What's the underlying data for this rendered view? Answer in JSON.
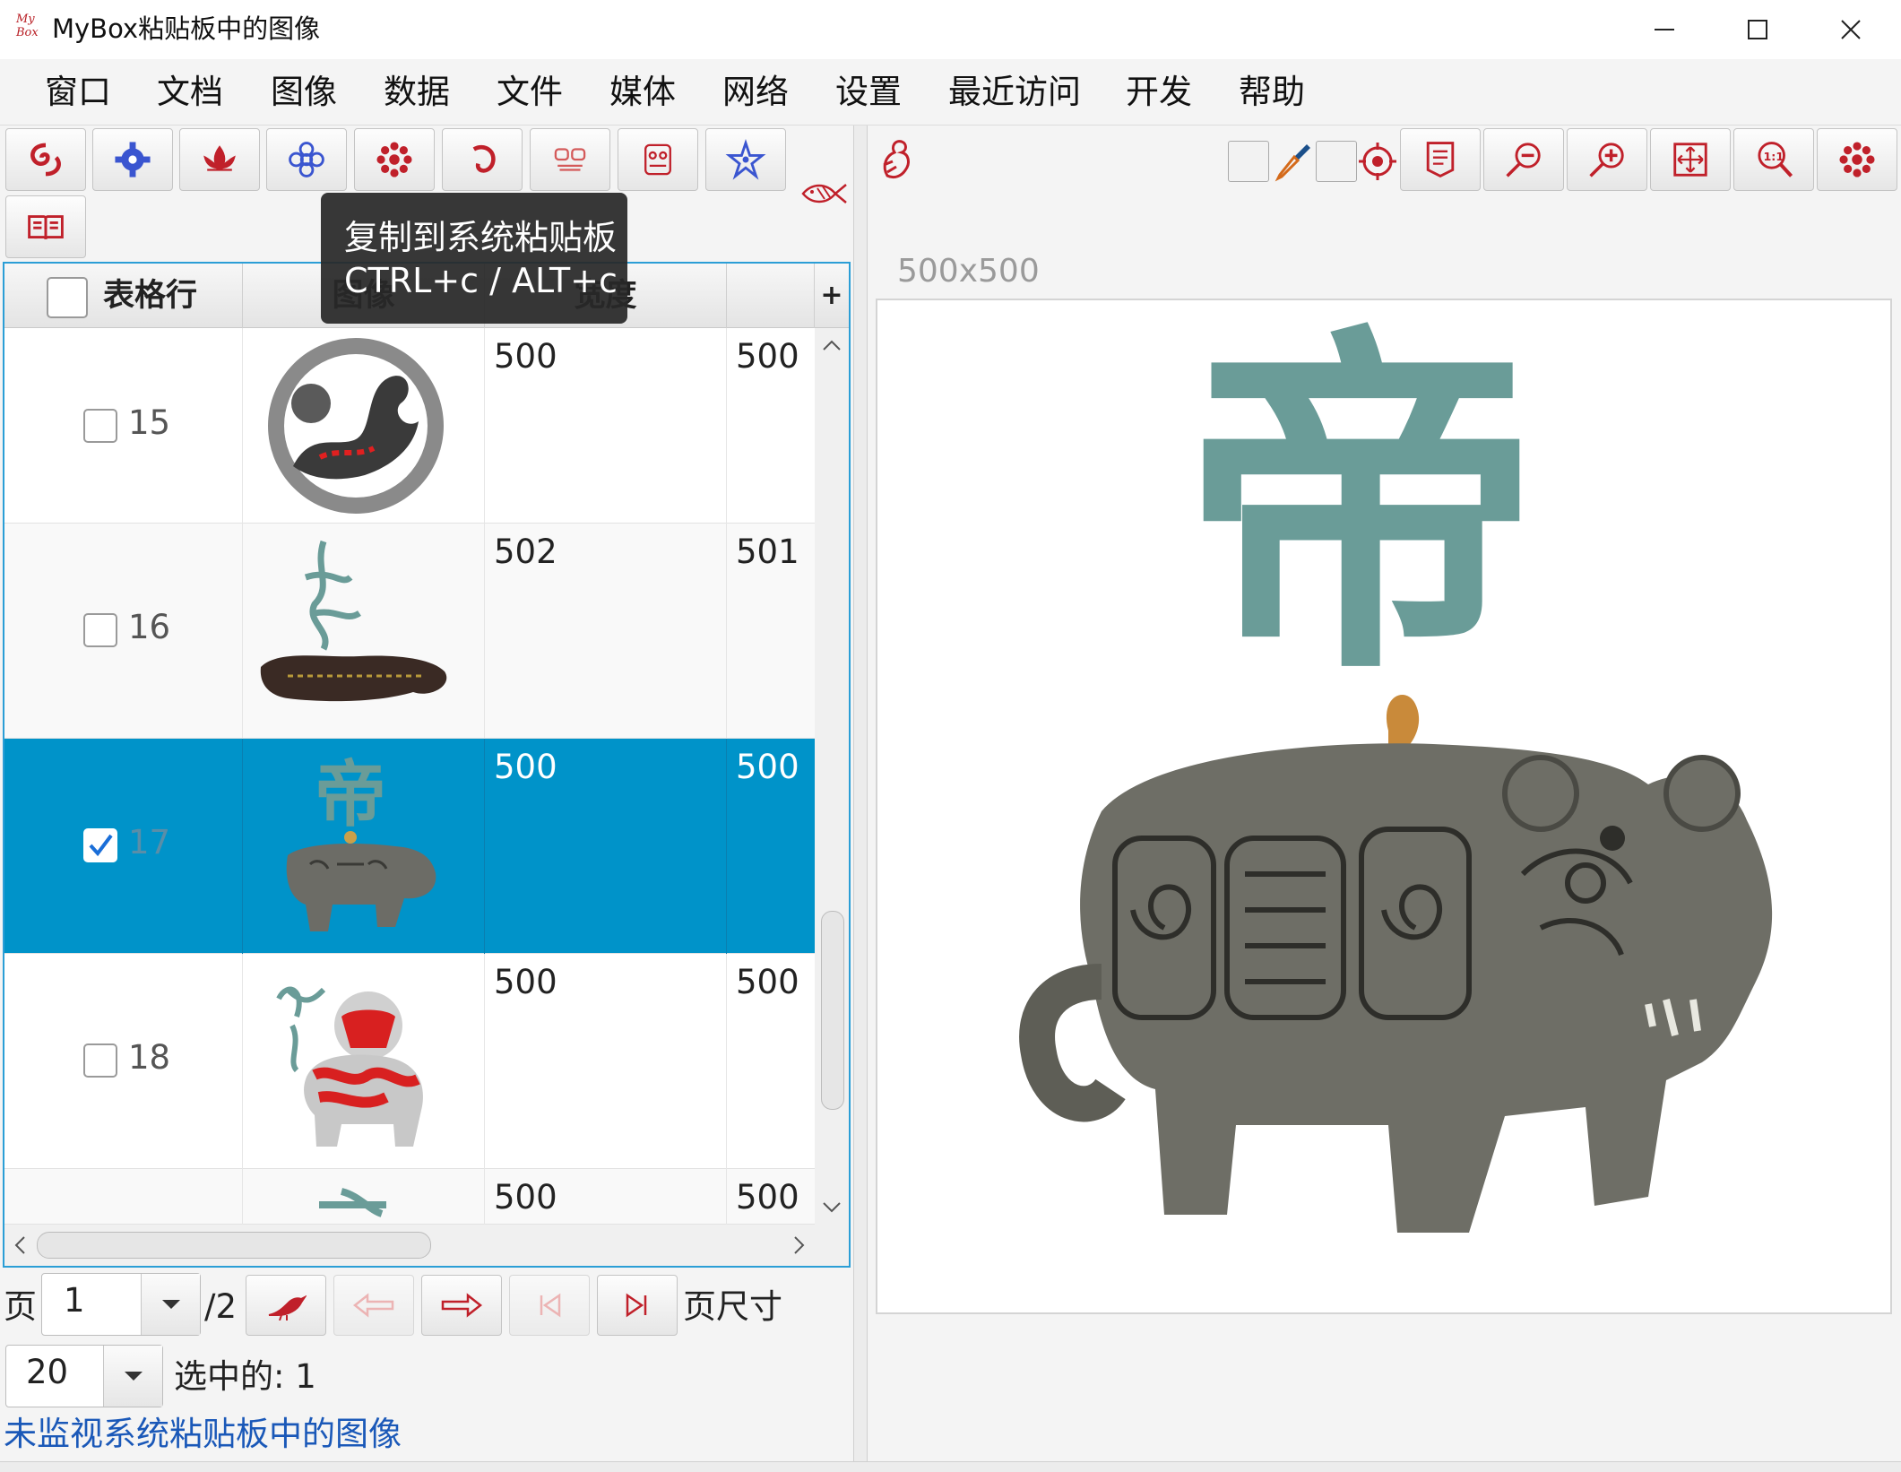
{
  "window": {
    "title": "MyBox粘贴板中的图像",
    "logo_text": "My Box",
    "controls": [
      "minimize-icon",
      "maximize-icon",
      "close-icon"
    ]
  },
  "menu": [
    "窗口",
    "文档",
    "图像",
    "数据",
    "文件",
    "媒体",
    "网络",
    "设置",
    "最近访问",
    "开发",
    "帮助"
  ],
  "toolbar": {
    "icons": [
      "swirl-icon",
      "gear-icon",
      "lotus-icon",
      "flower-icon",
      "chrysanthemum-icon",
      "curl-icon",
      "mask-icon",
      "totem-icon",
      "star-flower-icon",
      "book-icon",
      "fish-icon"
    ]
  },
  "tooltip": {
    "line1": "复制到系统粘贴板",
    "line2": "CTRL+c / ALT+c"
  },
  "table": {
    "headers": [
      "表格行",
      "图像",
      "宽度",
      ""
    ],
    "add_column_label": "+",
    "rows": [
      {
        "index": "15",
        "width": "500",
        "height": "500",
        "checked": false,
        "selected": false
      },
      {
        "index": "16",
        "width": "502",
        "height": "501",
        "checked": false,
        "selected": false
      },
      {
        "index": "17",
        "width": "500",
        "height": "500",
        "checked": true,
        "selected": true
      },
      {
        "index": "18",
        "width": "500",
        "height": "500",
        "checked": false,
        "selected": false
      },
      {
        "index": "",
        "width": "500",
        "height": "500",
        "checked": false,
        "selected": false
      }
    ]
  },
  "pager": {
    "page_label": "页",
    "page_value": "1",
    "page_total": "/2",
    "page_size_label": "页尺寸",
    "page_size_value": "20",
    "selected_text": "选中的: 1",
    "status_link": "未监视系统粘贴板中的图像"
  },
  "viewer": {
    "dimensions": "500x500",
    "glyph": "帝",
    "colors": {
      "accent": "#0093c9",
      "brand_red": "#c0202a",
      "glyph_teal": "#6a9c98"
    }
  }
}
